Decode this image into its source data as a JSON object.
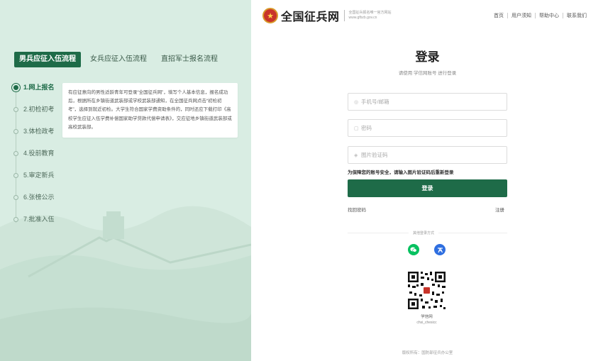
{
  "site": {
    "name": "全国征兵网",
    "subtitle_line1": "全国征兵报名唯一官方网站",
    "subtitle_line2": "www.gfbzb.gov.cn"
  },
  "top_nav": [
    "首页",
    "用户须知",
    "帮助中心",
    "联系我们"
  ],
  "process_tabs": [
    "男兵应征入伍流程",
    "女兵应征入伍流程",
    "直招军士报名流程"
  ],
  "steps": [
    {
      "label": "1.网上报名",
      "active": true
    },
    {
      "label": "2.初检初考",
      "active": false
    },
    {
      "label": "3.体检政考",
      "active": false
    },
    {
      "label": "4.役前教育",
      "active": false
    },
    {
      "label": "5.审定新兵",
      "active": false
    },
    {
      "label": "6.张榜公示",
      "active": false
    },
    {
      "label": "7.批准入伍",
      "active": false
    }
  ],
  "step_description": "有应征意向的男性适龄青年可登录“全国征兵网”，填写个人基本信息，报名成功后，根据所在乡镇街道武装部或学校武装部通知，在全国征兵网点击“初检初考”，选择到就近初检。大学生符合国家学费资助条件的，同时还应下载打印《高校学生应征入伍学费补偿国家助学贷款代偿申请表》，交应征地乡镇街道武装部或高校武装部。",
  "login": {
    "title": "登录",
    "subtitle": "请使用 学信网账号 进行登录",
    "phone_placeholder": "手机号/邮箱",
    "password_placeholder": "密码",
    "captcha_placeholder": "图片验证码",
    "tip": "为保障您的账号安全，请输入图片验证码后重新登录",
    "submit_label": "登录",
    "forgot_label": "找回密码",
    "register_label": "注册",
    "other_methods_label": "其他登录方式",
    "qr_name": "学信网",
    "qr_id": "chsi_chesicc"
  },
  "footer": "版权所有：国防部征兵办公室",
  "colors": {
    "accent": "#1e6b48",
    "left_panel_bg": "#d9ede3",
    "wechat": "#07c160",
    "chsi": "#2f6fe0"
  },
  "icons": {
    "emblem": "national-emblem-icon",
    "wechat": "wechat-icon",
    "chsi": "chsi-icon"
  }
}
